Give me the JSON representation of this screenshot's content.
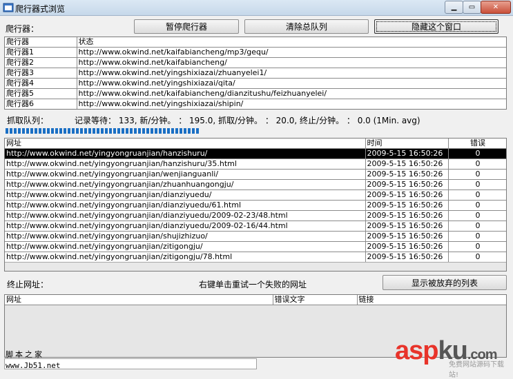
{
  "window": {
    "title": "爬行器式浏览"
  },
  "crawler_bar": {
    "label": "爬行器：",
    "pause_button": "暂停爬行器",
    "clear_button": "清除总队列",
    "hide_button": "隐藏这个窗口"
  },
  "crawlers": {
    "headers": [
      "爬行器",
      "状态"
    ],
    "rows": [
      [
        "爬行器1",
        "http://www.okwind.net/kaifabiancheng/mp3/gequ/"
      ],
      [
        "爬行器2",
        "http://www.okwind.net/kaifabiancheng/"
      ],
      [
        "爬行器3",
        "http://www.okwind.net/yingshixiazai/zhuanyelei1/"
      ],
      [
        "爬行器4",
        "http://www.okwind.net/yingshixiazai/qita/"
      ],
      [
        "爬行器5",
        "http://www.okwind.net/kaifabiancheng/dianzitushu/feizhuanyelei/"
      ],
      [
        "爬行器6",
        "http://www.okwind.net/yingshixiazai/shipin/"
      ]
    ]
  },
  "queue": {
    "label": "抓取队列：",
    "stats": "记录等待： 133, 新/分钟。 ： 195.0, 抓取/分钟。 ： 20.0, 终止/分钟。 ： 0.0 (1Min. avg)",
    "progress_fraction": 0.39
  },
  "urls": {
    "headers": [
      "网址",
      "时间",
      "错误"
    ],
    "rows": [
      [
        "http://www.okwind.net/yingyongruanjian/hanzishuru/",
        "2009-5-15 16:50:26",
        "0"
      ],
      [
        "http://www.okwind.net/yingyongruanjian/hanzishuru/35.html",
        "2009-5-15 16:50:26",
        "0"
      ],
      [
        "http://www.okwind.net/yingyongruanjian/wenjianguanli/",
        "2009-5-15 16:50:26",
        "0"
      ],
      [
        "http://www.okwind.net/yingyongruanjian/zhuanhuangongju/",
        "2009-5-15 16:50:26",
        "0"
      ],
      [
        "http://www.okwind.net/yingyongruanjian/dianziyuedu/",
        "2009-5-15 16:50:26",
        "0"
      ],
      [
        "http://www.okwind.net/yingyongruanjian/dianziyuedu/61.html",
        "2009-5-15 16:50:26",
        "0"
      ],
      [
        "http://www.okwind.net/yingyongruanjian/dianziyuedu/2009-02-23/48.html",
        "2009-5-15 16:50:26",
        "0"
      ],
      [
        "http://www.okwind.net/yingyongruanjian/dianziyuedu/2009-02-16/44.html",
        "2009-5-15 16:50:26",
        "0"
      ],
      [
        "http://www.okwind.net/yingyongruanjian/shujizhizuo/",
        "2009-5-15 16:50:26",
        "0"
      ],
      [
        "http://www.okwind.net/yingyongruanjian/zitigongju/",
        "2009-5-15 16:50:26",
        "0"
      ],
      [
        "http://www.okwind.net/yingyongruanjian/zitigongju/78.html",
        "2009-5-15 16:50:26",
        "0"
      ]
    ]
  },
  "failed": {
    "label": "终止网址：",
    "hint": "右键单击重试一个失败的网址",
    "show_button": "显示被放弃的列表",
    "headers": [
      "网址",
      "错误文字",
      "链接"
    ]
  },
  "watermark": {
    "line1": "脚本之家",
    "line2": "www.Jb51.net",
    "brand": "aspku",
    "brand_suffix": ".com",
    "tagline": "免费网站源码下载站!"
  },
  "colors": {
    "progress": "#1a6fc4",
    "brand_red": "#e8332a",
    "brand_gray": "#555555"
  }
}
